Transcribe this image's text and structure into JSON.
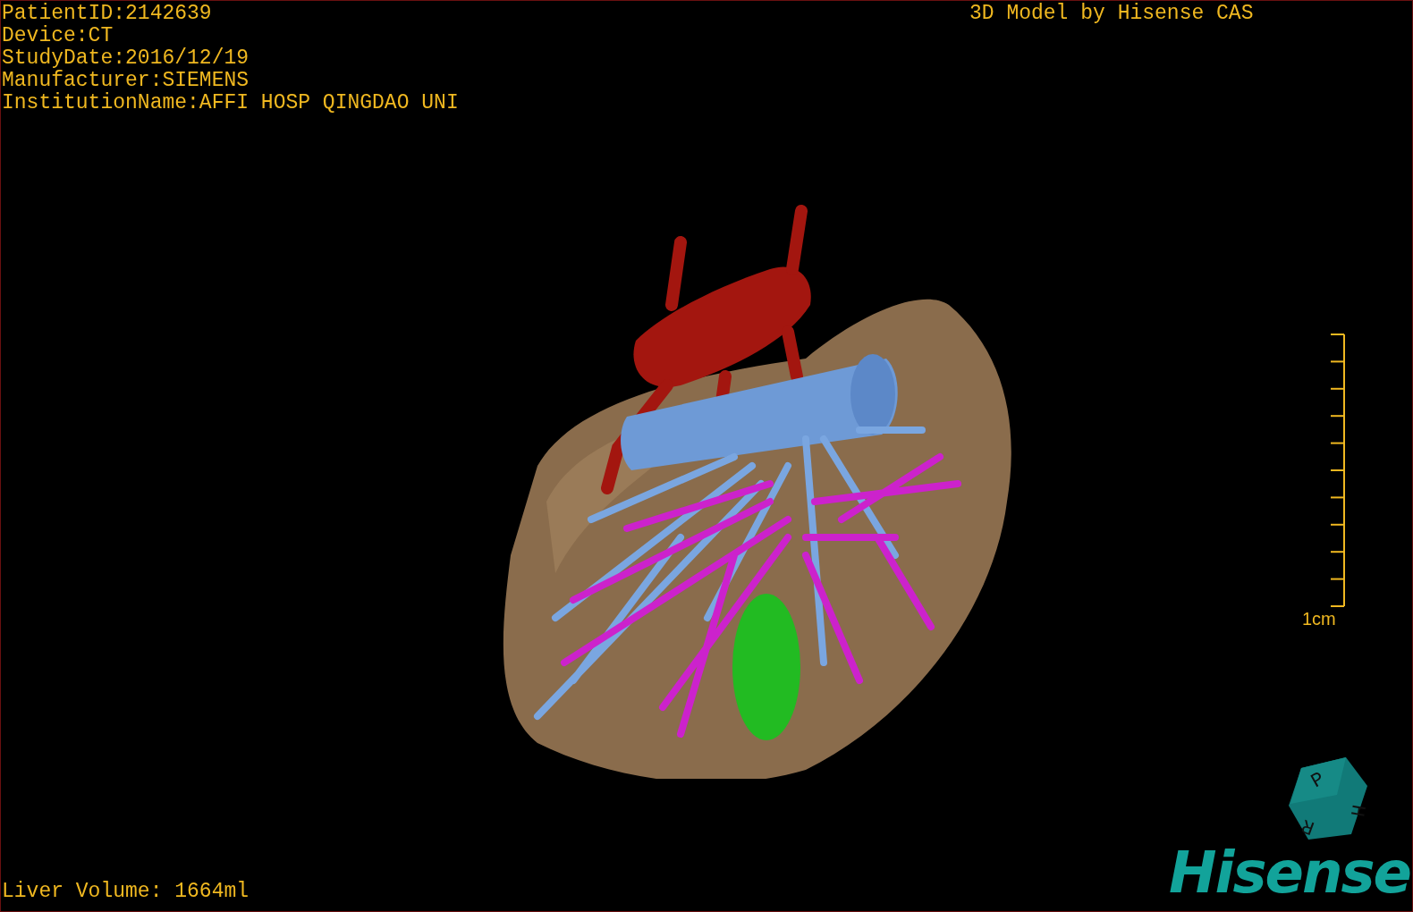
{
  "patient_info": [
    "PatientID:2142639",
    "Device:CT",
    "StudyDate:2016/12/19",
    "Manufacturer:SIEMENS",
    "InstitutionName:AFFI HOSP QINGDAO UNI"
  ],
  "header_right": "3D Model by Hisense CAS",
  "scale_bar": {
    "label": "1cm"
  },
  "orientation_cube": {
    "faces": [
      "P",
      "H",
      "R"
    ]
  },
  "logo": "Hisense",
  "liver_volume": "Liver Volume: 1664ml"
}
